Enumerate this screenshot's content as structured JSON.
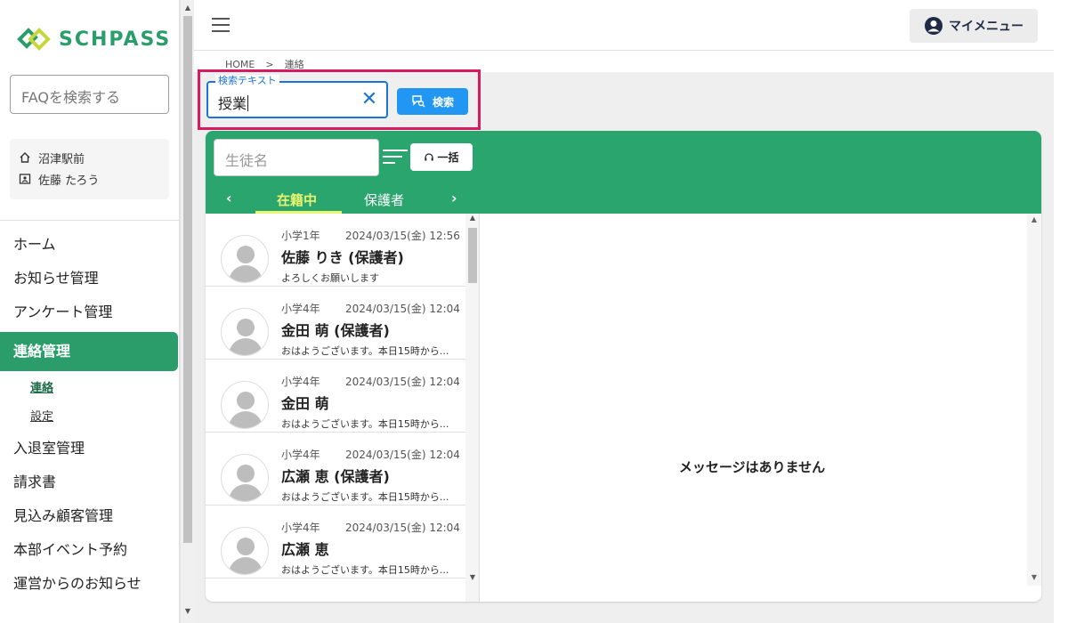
{
  "app": {
    "brand": "SCHPASS",
    "brand_color": "#2a9d6a",
    "accent": "#2196f3",
    "highlight": "#d81b60"
  },
  "sidebar": {
    "faq_placeholder": "FAQを検索する",
    "user": {
      "school_icon": "home-icon",
      "school": "沼津駅前",
      "user_icon": "id-badge-icon",
      "name": "佐藤 たろう"
    },
    "nav": [
      {
        "label": "ホーム"
      },
      {
        "label": "お知らせ管理"
      },
      {
        "label": "アンケート管理"
      },
      {
        "label": "連絡管理",
        "active": true
      },
      {
        "label": "入退室管理"
      },
      {
        "label": "請求書"
      },
      {
        "label": "見込み顧客管理"
      },
      {
        "label": "本部イベント予約"
      },
      {
        "label": "運営からのお知らせ"
      }
    ],
    "subnav": [
      {
        "label": "連絡",
        "current": true
      },
      {
        "label": "設定"
      }
    ]
  },
  "header": {
    "menu_icon": "hamburger-icon",
    "mymenu_label": "マイメニュー",
    "mymenu_icon": "account-circle-icon"
  },
  "breadcrumb": {
    "home": "HOME",
    "separator": ">",
    "current": "連絡"
  },
  "search": {
    "legend": "検索テキスト",
    "value": "授業",
    "clear_icon": "close-icon",
    "button_label": "検索",
    "button_icon": "chat-search-icon"
  },
  "panel": {
    "student_placeholder": "生徒名",
    "filter_icon": "sort-icon",
    "bulk_label": "一括",
    "bulk_icon": "headset-icon",
    "tabs": [
      {
        "label": "在籍中",
        "active": true
      },
      {
        "label": "保護者"
      }
    ],
    "prev_icon": "chevron-left-icon",
    "next_icon": "chevron-right-icon",
    "empty_message": "メッセージはありません"
  },
  "conversations": [
    {
      "grade": "小学1年",
      "time": "2024/03/15(金) 12:56",
      "name": "佐藤 りき (保護者)",
      "preview": "よろしくお願いします"
    },
    {
      "grade": "小学4年",
      "time": "2024/03/15(金) 12:04",
      "name": "金田 萌 (保護者)",
      "preview": "おはようございます。本日15時から..."
    },
    {
      "grade": "小学4年",
      "time": "2024/03/15(金) 12:04",
      "name": "金田 萌",
      "preview": "おはようございます。本日15時から..."
    },
    {
      "grade": "小学4年",
      "time": "2024/03/15(金) 12:04",
      "name": "広瀬 恵 (保護者)",
      "preview": "おはようございます。本日15時から..."
    },
    {
      "grade": "小学4年",
      "time": "2024/03/15(金) 12:04",
      "name": "広瀬 恵",
      "preview": "おはようございます。本日15時から..."
    }
  ]
}
